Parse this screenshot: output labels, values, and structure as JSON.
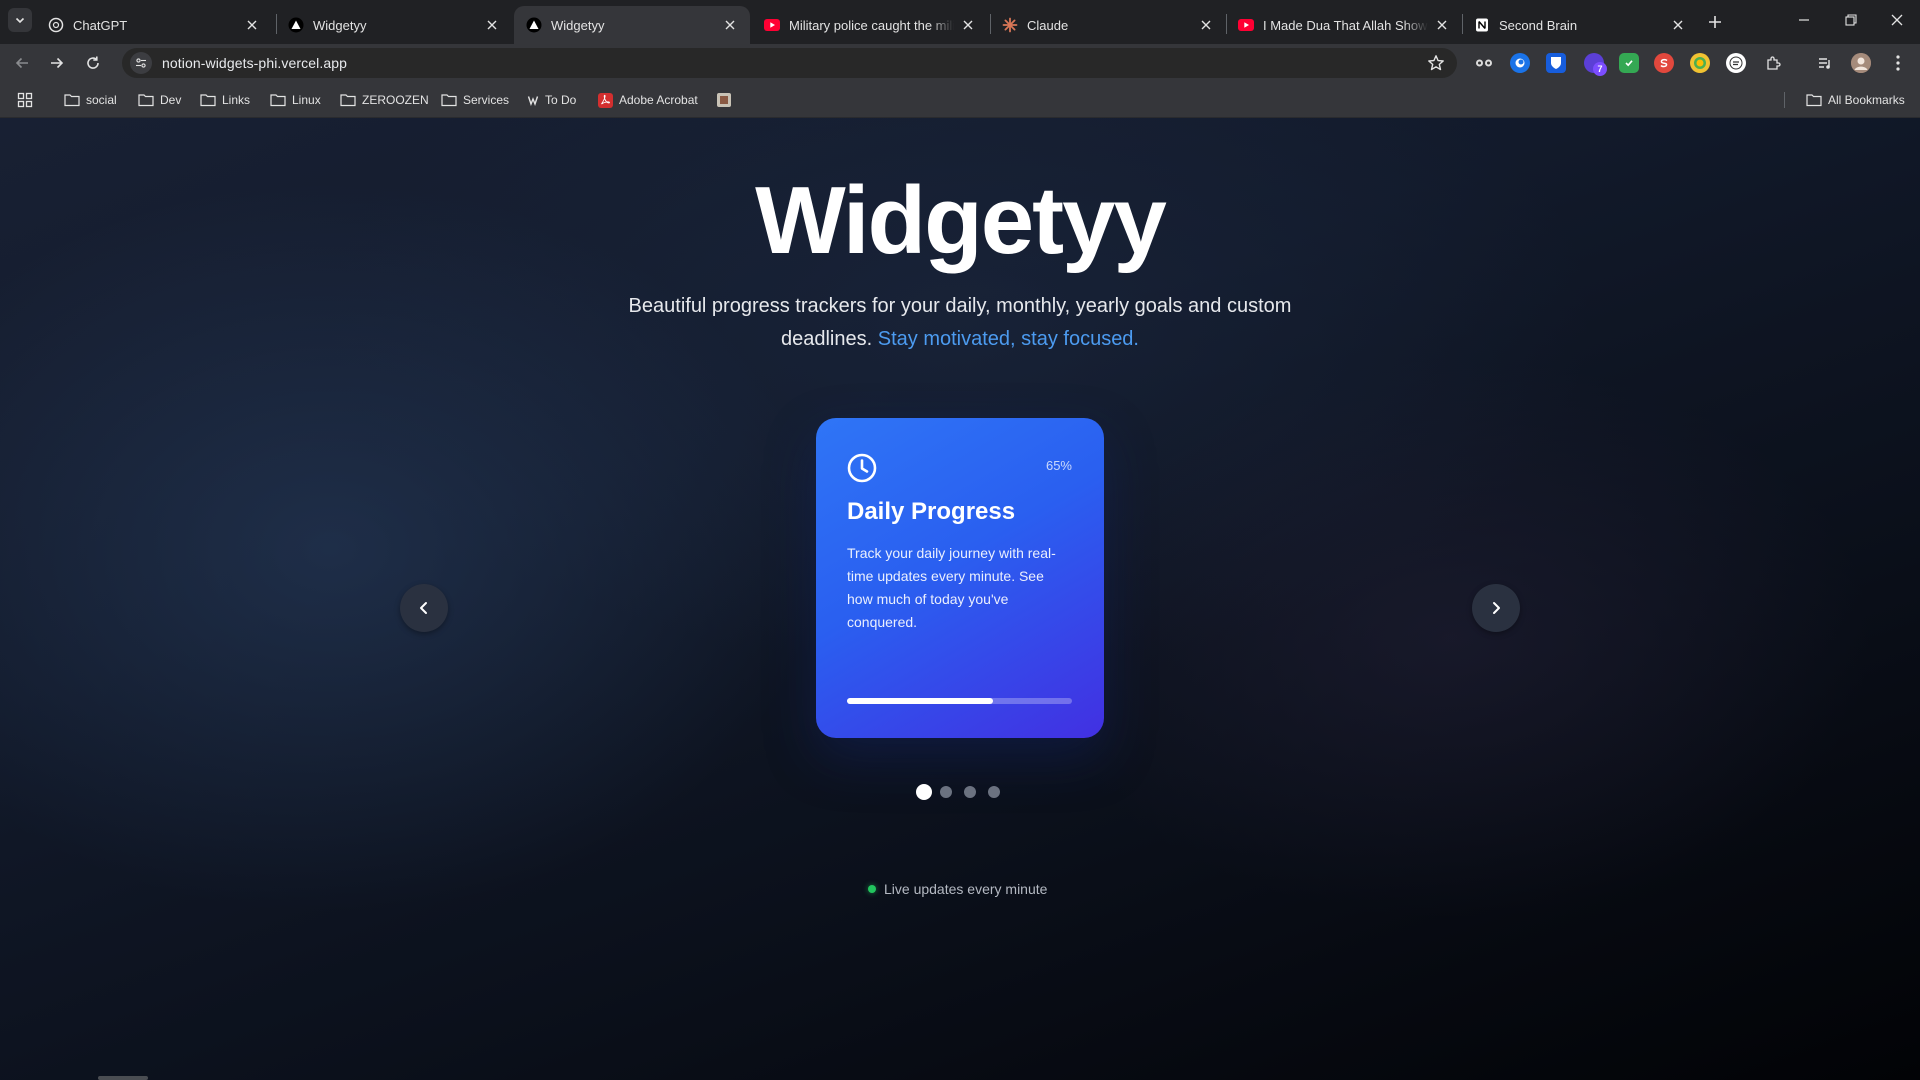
{
  "browser": {
    "tabs": [
      {
        "title": "ChatGPT",
        "favicon": "chatgpt-icon",
        "active": false
      },
      {
        "title": "Widgetyy",
        "favicon": "triangle-icon",
        "active": false
      },
      {
        "title": "Widgetyy",
        "favicon": "triangle-icon",
        "active": true
      },
      {
        "title": "Military police caught the milita",
        "favicon": "youtube-icon",
        "active": false
      },
      {
        "title": "Claude",
        "favicon": "claude-icon",
        "active": false
      },
      {
        "title": "I Made Dua That Allah Shows Th",
        "favicon": "youtube-icon",
        "active": false
      },
      {
        "title": "Second Brain",
        "favicon": "notion-icon",
        "active": false
      }
    ],
    "url": "notion-widgets-phi.vercel.app",
    "extension_badge": "7",
    "bookmarks": [
      {
        "label": "social",
        "icon": "folder-icon"
      },
      {
        "label": "Dev",
        "icon": "folder-icon"
      },
      {
        "label": "Links",
        "icon": "folder-icon"
      },
      {
        "label": "Linux",
        "icon": "folder-icon"
      },
      {
        "label": "ZEROOZEN",
        "icon": "folder-icon"
      },
      {
        "label": "Services",
        "icon": "folder-icon"
      },
      {
        "label": "To Do",
        "icon": "todo-icon"
      },
      {
        "label": "Adobe Acrobat",
        "icon": "acrobat-icon"
      }
    ],
    "all_bookmarks": "All Bookmarks"
  },
  "hero": {
    "title": "Widgetyy",
    "subtitle": "Beautiful progress trackers for your daily, monthly, yearly goals and custom deadlines.",
    "subtitle_accent": "Stay motivated, stay focused."
  },
  "card": {
    "icon": "clock-icon",
    "percent": "65%",
    "progress": 0.65,
    "title": "Daily Progress",
    "description": "Track your daily journey with real-time updates every minute. See how much of today you've conquered."
  },
  "carousel": {
    "slide_count": 4,
    "active_index": 0
  },
  "status": {
    "live_text": "Live updates every minute"
  },
  "colors": {
    "accent": "#4c9bf0",
    "card_start": "#2f75f6",
    "card_end": "#4230e2",
    "live": "#22c55e"
  }
}
